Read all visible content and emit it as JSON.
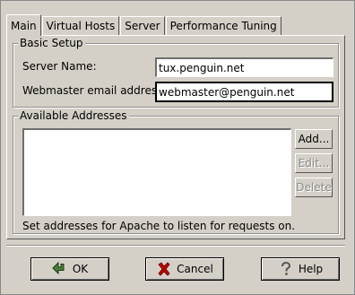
{
  "tabs": [
    {
      "label": "Main",
      "active": true
    },
    {
      "label": "Virtual Hosts",
      "active": false
    },
    {
      "label": "Server",
      "active": false
    },
    {
      "label": "Performance Tuning",
      "active": false
    }
  ],
  "basic_setup": {
    "title": "Basic Setup",
    "server_name_label": "Server Name:",
    "server_name_value": "tux.penguin.net",
    "webmaster_label": "Webmaster email address:",
    "webmaster_value": "webmaster@penguin.net"
  },
  "addresses": {
    "title": "Available Addresses",
    "items": [],
    "add_label": "Add...",
    "edit_label": "Edit...",
    "delete_label": "Delete",
    "hint": "Set addresses for Apache to listen for requests on."
  },
  "buttons": {
    "ok_label": "OK",
    "cancel_label": "Cancel",
    "help_label": "Help"
  },
  "icons": {
    "ok": "ok-arrow-icon",
    "cancel": "cancel-x-icon",
    "help": "help-question-icon"
  },
  "colors": {
    "background": "#d4d0c8",
    "cancel_icon": "#c00000",
    "ok_icon": "#4e7d3a"
  }
}
